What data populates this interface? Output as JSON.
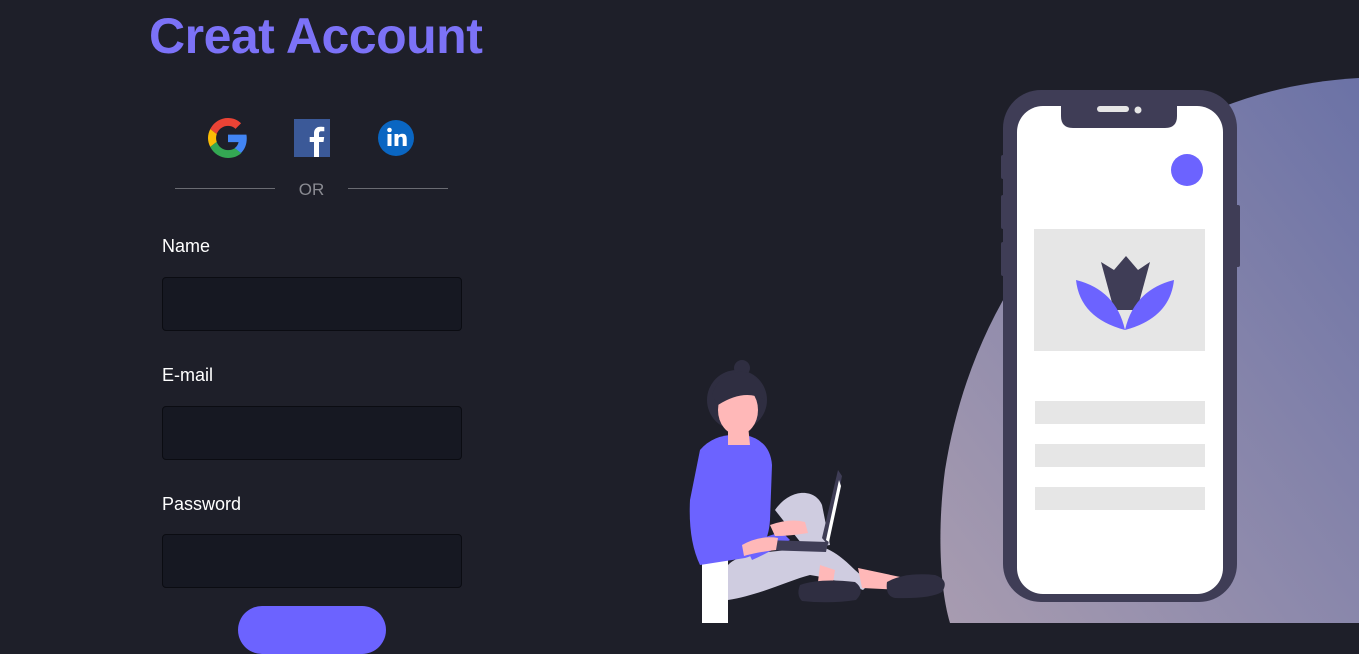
{
  "page": {
    "title": "Creat Account"
  },
  "social": {
    "google": "google-icon",
    "facebook": "facebook-icon",
    "linkedin": "linkedin-icon",
    "divider_text": "OR"
  },
  "form": {
    "name_label": "Name",
    "email_label": "E-mail",
    "password_label": "Password",
    "name_value": "",
    "email_value": "",
    "password_value": ""
  },
  "colors": {
    "background": "#1e1f29",
    "accent": "#6c63ff",
    "title": "#7c72f7",
    "input_bg": "#161822"
  },
  "illustration": {
    "icons": [
      "phone-illustration",
      "person-with-laptop-illustration",
      "lotus-logo-icon"
    ]
  }
}
